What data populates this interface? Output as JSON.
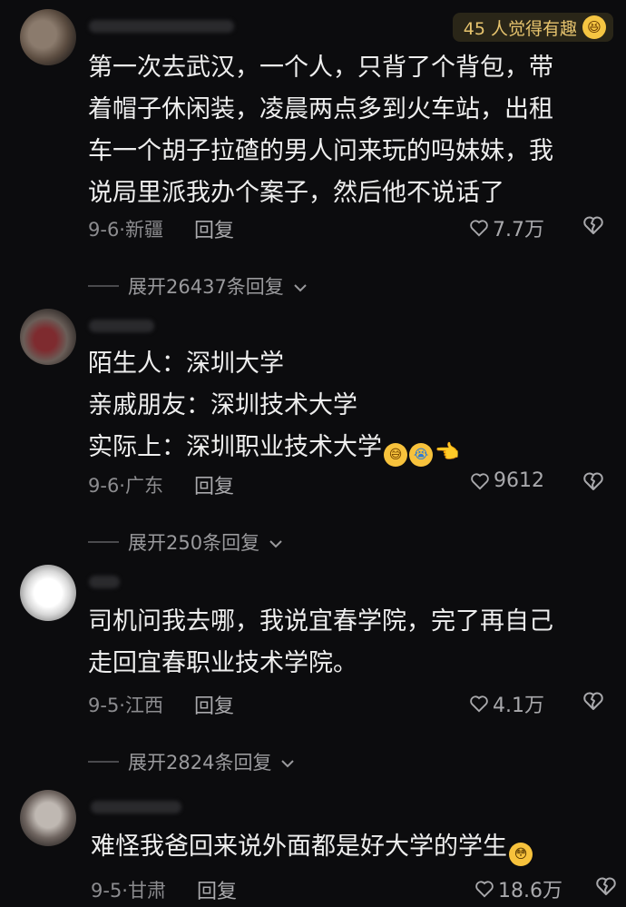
{
  "badge": {
    "text": "45 人觉得有趣",
    "emoji_icon": "laughing-face-icon"
  },
  "comments": [
    {
      "lines": [
        "第一次去武汉，一个人，只背了个背包，带",
        "着帽子休闲装，凌晨两点多到火车站，出租",
        "车一个胡子拉碴的男人问来玩的吗妹妹，我",
        "说局里派我办个案子，然后他不说话了"
      ],
      "date_location": "9-6·新疆",
      "reply_label": "回复",
      "likes": "7.7万",
      "expand_label": "展开26437条回复"
    },
    {
      "lines": [
        "陌生人：深圳大学",
        "亲戚朋友：深圳技术大学",
        "实际上：深圳职业技术大学"
      ],
      "trailing_emojis": [
        "grinning-sweat-icon",
        "crying-face-icon",
        "pointing-hand-icon"
      ],
      "date_location": "9-6·广东",
      "reply_label": "回复",
      "likes": "9612",
      "expand_label": "展开250条回复"
    },
    {
      "lines": [
        "司机问我去哪，我说宜春学院，完了再自己",
        "走回宜春职业技术学院。"
      ],
      "date_location": "9-5·江西",
      "reply_label": "回复",
      "likes": "4.1万",
      "expand_label": "展开2824条回复"
    },
    {
      "lines": [
        "难怪我爸回来说外面都是好大学的学生"
      ],
      "trailing_emojis": [
        "flushed-face-icon"
      ],
      "date_location": "9-5·甘肃",
      "reply_label": "回复",
      "likes": "18.6万"
    }
  ],
  "colors": {
    "background": "#0c0c0e",
    "text": "#eeeeee",
    "meta": "#8c8c8f",
    "badge_text": "#e7c46e"
  }
}
